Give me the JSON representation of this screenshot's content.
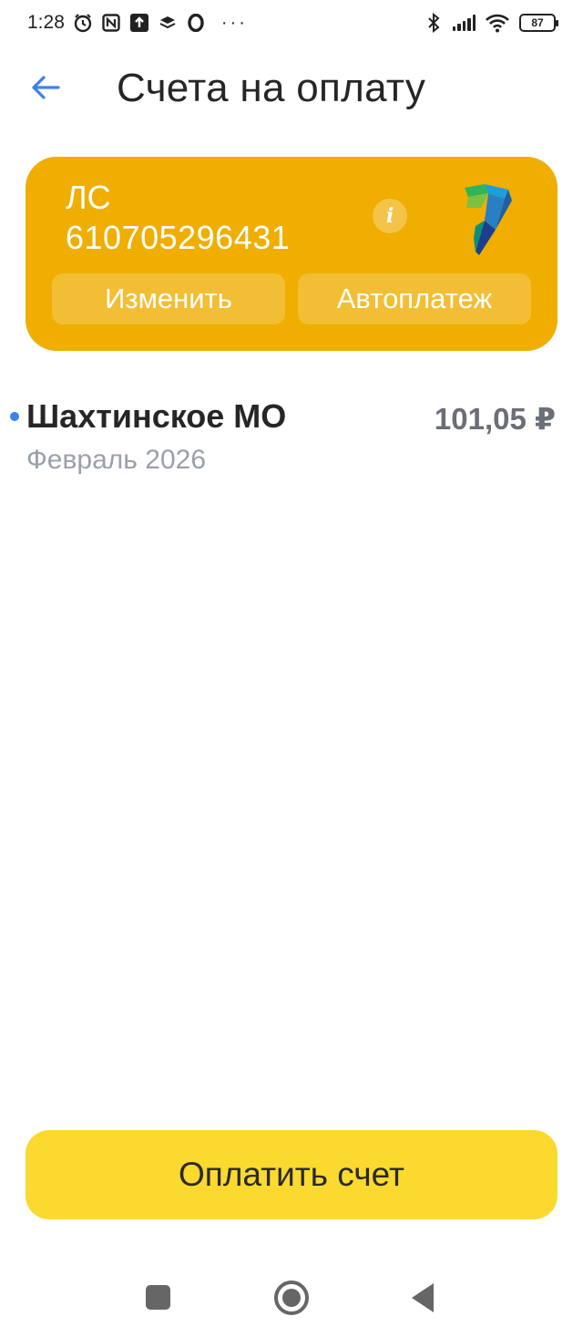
{
  "status_bar": {
    "time": "1:28",
    "battery": "87",
    "icons": [
      "alarm-icon",
      "nfc-icon",
      "upload-icon",
      "layers-icon",
      "opera-icon",
      "more-dots-icon",
      "bluetooth-icon",
      "signal-icon",
      "wifi-icon",
      "battery-icon"
    ],
    "dots": "···"
  },
  "header": {
    "title": "Счета на оплату",
    "back_icon": "arrow-left-icon"
  },
  "account": {
    "label": "ЛС",
    "number": "610705296431",
    "info_icon": "i",
    "change_label": "Изменить",
    "autopay_label": "Автоплатеж",
    "card_color": "#efae00"
  },
  "invoices": [
    {
      "name": "Шахтинское МО",
      "amount": "101,05 ₽",
      "period": "Февраль 2026",
      "unread_dot_color": "#3b82e8"
    }
  ],
  "pay_button": {
    "label": "Оплатить счет",
    "color": "#fbd92e"
  },
  "accent_color": "#3b82e8"
}
